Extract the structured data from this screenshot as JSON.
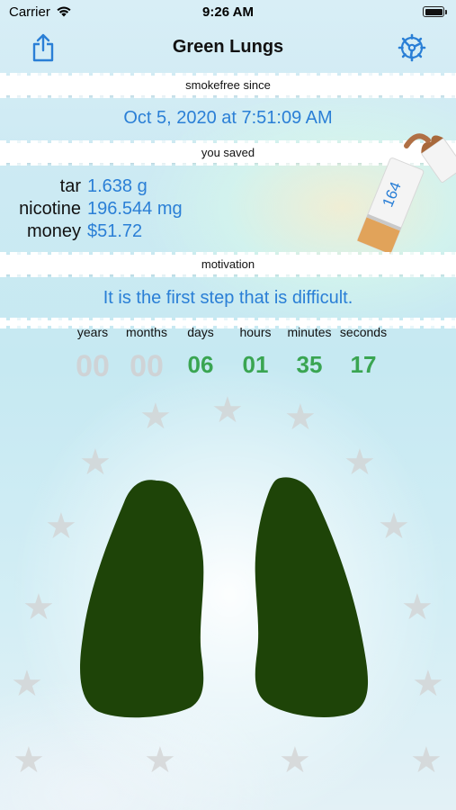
{
  "status_bar": {
    "carrier": "Carrier",
    "time": "9:26 AM"
  },
  "nav": {
    "title": "Green Lungs"
  },
  "smokefree": {
    "label": "smokefree since",
    "date": "Oct 5, 2020 at 7:51:09 AM"
  },
  "saved": {
    "label": "you saved",
    "items": [
      {
        "name": "tar",
        "value": "1.638 g"
      },
      {
        "name": "nicotine",
        "value": "196.544 mg"
      },
      {
        "name": "money",
        "value": "$51.72"
      }
    ],
    "cigarette_count": "164"
  },
  "motivation": {
    "label": "motivation",
    "quote": "It is the first step that is difficult."
  },
  "timer": {
    "labels": [
      "years",
      "months",
      "days",
      "hours",
      "minutes",
      "seconds"
    ],
    "values": [
      "00",
      "00",
      "06",
      "01",
      "35",
      "17"
    ]
  },
  "colors": {
    "accent": "#2a7fd6",
    "timer_active": "#3aa552",
    "timer_inactive": "#cfd3d6",
    "lungs": "#1e4408"
  },
  "icons": [
    "wifi-icon",
    "battery-icon",
    "share-icon",
    "settings-gear-icon",
    "cigarette-icon",
    "star-icon",
    "lungs-icon"
  ]
}
